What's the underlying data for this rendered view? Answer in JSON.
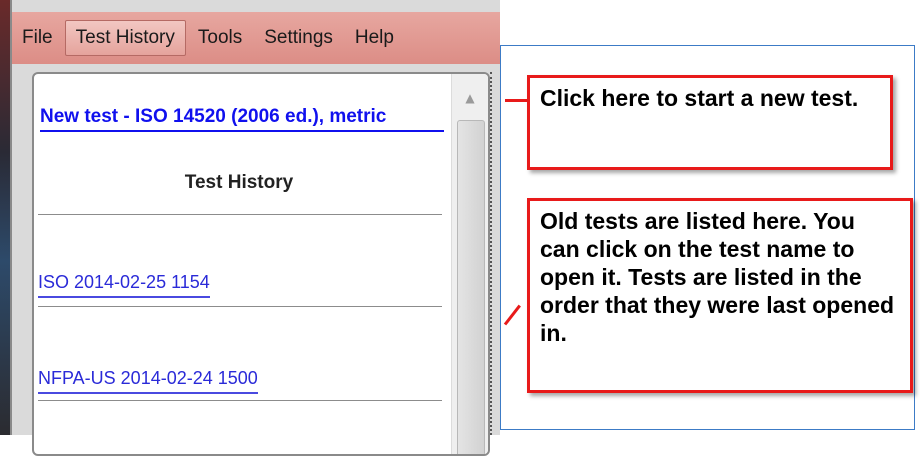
{
  "menu": {
    "items": [
      {
        "label": "File"
      },
      {
        "label": "Test History",
        "active": true
      },
      {
        "label": "Tools"
      },
      {
        "label": "Settings"
      },
      {
        "label": "Help"
      }
    ]
  },
  "panel": {
    "new_test_link": "New test - ISO 14520 (2006 ed.), metric",
    "history_title": "Test History",
    "history_items": [
      {
        "label": "ISO 2014-02-25 1154"
      },
      {
        "label": "NFPA-US 2014-02-24 1500"
      }
    ]
  },
  "annotations": {
    "new_test": "Click here to start a new test.",
    "old_tests": "Old tests are listed here. You can click on the test name to open it. Tests are listed in the order that they were last opened in."
  },
  "colors": {
    "menubar": "#dc8d86",
    "link": "#1010ee",
    "callout_border": "#e81a1a",
    "frame_border": "#3c7bc6"
  }
}
